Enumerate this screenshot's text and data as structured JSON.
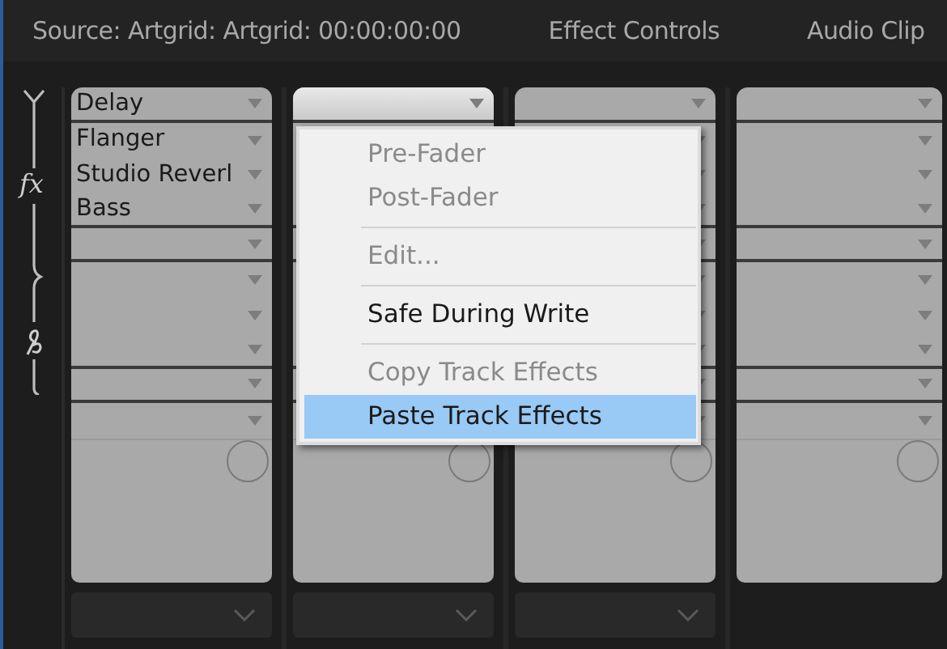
{
  "tabs": [
    {
      "label": "Source: Artgrid: Artgrid: 00:00:00:00"
    },
    {
      "label": "Effect Controls"
    },
    {
      "label": "Audio Clip"
    }
  ],
  "sidebar": {
    "effects_label": "fx"
  },
  "tracks": [
    {
      "effects": [
        "Delay",
        "Flanger",
        "Studio Reverl",
        "Bass"
      ],
      "output_menu": true,
      "slot_focused": false
    },
    {
      "output_menu": true,
      "slot_focused": true
    },
    {
      "output_menu": true,
      "slot_focused": false
    },
    {
      "output_menu": false,
      "slot_focused": false
    }
  ],
  "context_menu": {
    "items": [
      {
        "kind": "item",
        "label": "Pre-Fader",
        "disabled": true,
        "selected": false
      },
      {
        "kind": "item",
        "label": "Post-Fader",
        "disabled": true,
        "selected": false
      },
      {
        "kind": "separator"
      },
      {
        "kind": "item",
        "label": "Edit...",
        "disabled": true,
        "selected": false
      },
      {
        "kind": "separator"
      },
      {
        "kind": "item",
        "label": "Safe During Write",
        "disabled": false,
        "selected": false
      },
      {
        "kind": "separator"
      },
      {
        "kind": "item",
        "label": "Copy Track Effects",
        "disabled": true,
        "selected": false
      },
      {
        "kind": "item",
        "label": "Paste Track Effects",
        "disabled": false,
        "selected": true
      }
    ]
  }
}
